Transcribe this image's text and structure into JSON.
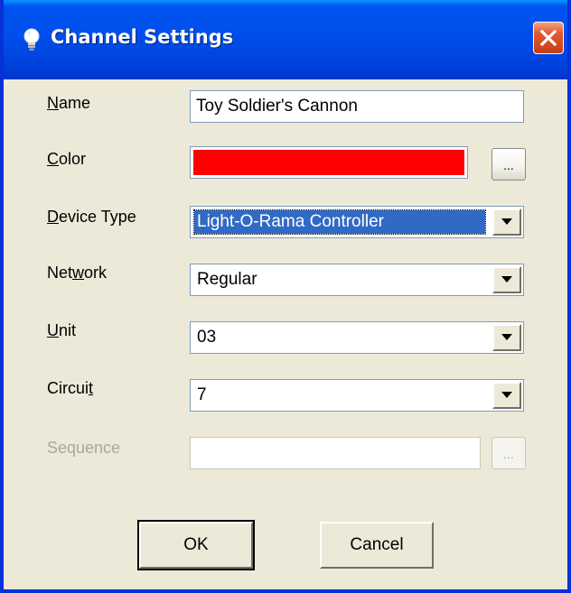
{
  "window": {
    "title": "Channel Settings",
    "icon": "lightbulb-icon",
    "close_icon": "close-icon"
  },
  "fields": {
    "name": {
      "label": "Name",
      "mnemonic": "N",
      "rest": "ame",
      "value": "Toy Soldier's Cannon"
    },
    "color": {
      "label": "Color",
      "mnemonic": "C",
      "rest": "olor",
      "value": "#ff0000",
      "button_label": "..."
    },
    "device_type": {
      "label": "Device Type",
      "mnemonic": "D",
      "rest": "evice Type",
      "value": "Light-O-Rama Controller"
    },
    "network": {
      "label": "Network",
      "before": "Net",
      "mnemonic": "w",
      "after": "ork",
      "value": "Regular"
    },
    "unit": {
      "label": "Unit",
      "mnemonic": "U",
      "rest": "nit",
      "value": "03"
    },
    "circuit": {
      "label": "Circuit",
      "before": "Circui",
      "mnemonic": "t",
      "value": "7"
    },
    "sequence": {
      "label": "Sequence",
      "value": "",
      "button_label": "...",
      "disabled": true
    }
  },
  "buttons": {
    "ok": "OK",
    "cancel": "Cancel"
  },
  "colors": {
    "titlebar": "#0054e3",
    "dialog_bg": "#ece9d8",
    "selection": "#316ac5",
    "swatch": "#ff0000",
    "disabled_text": "#aca899"
  }
}
